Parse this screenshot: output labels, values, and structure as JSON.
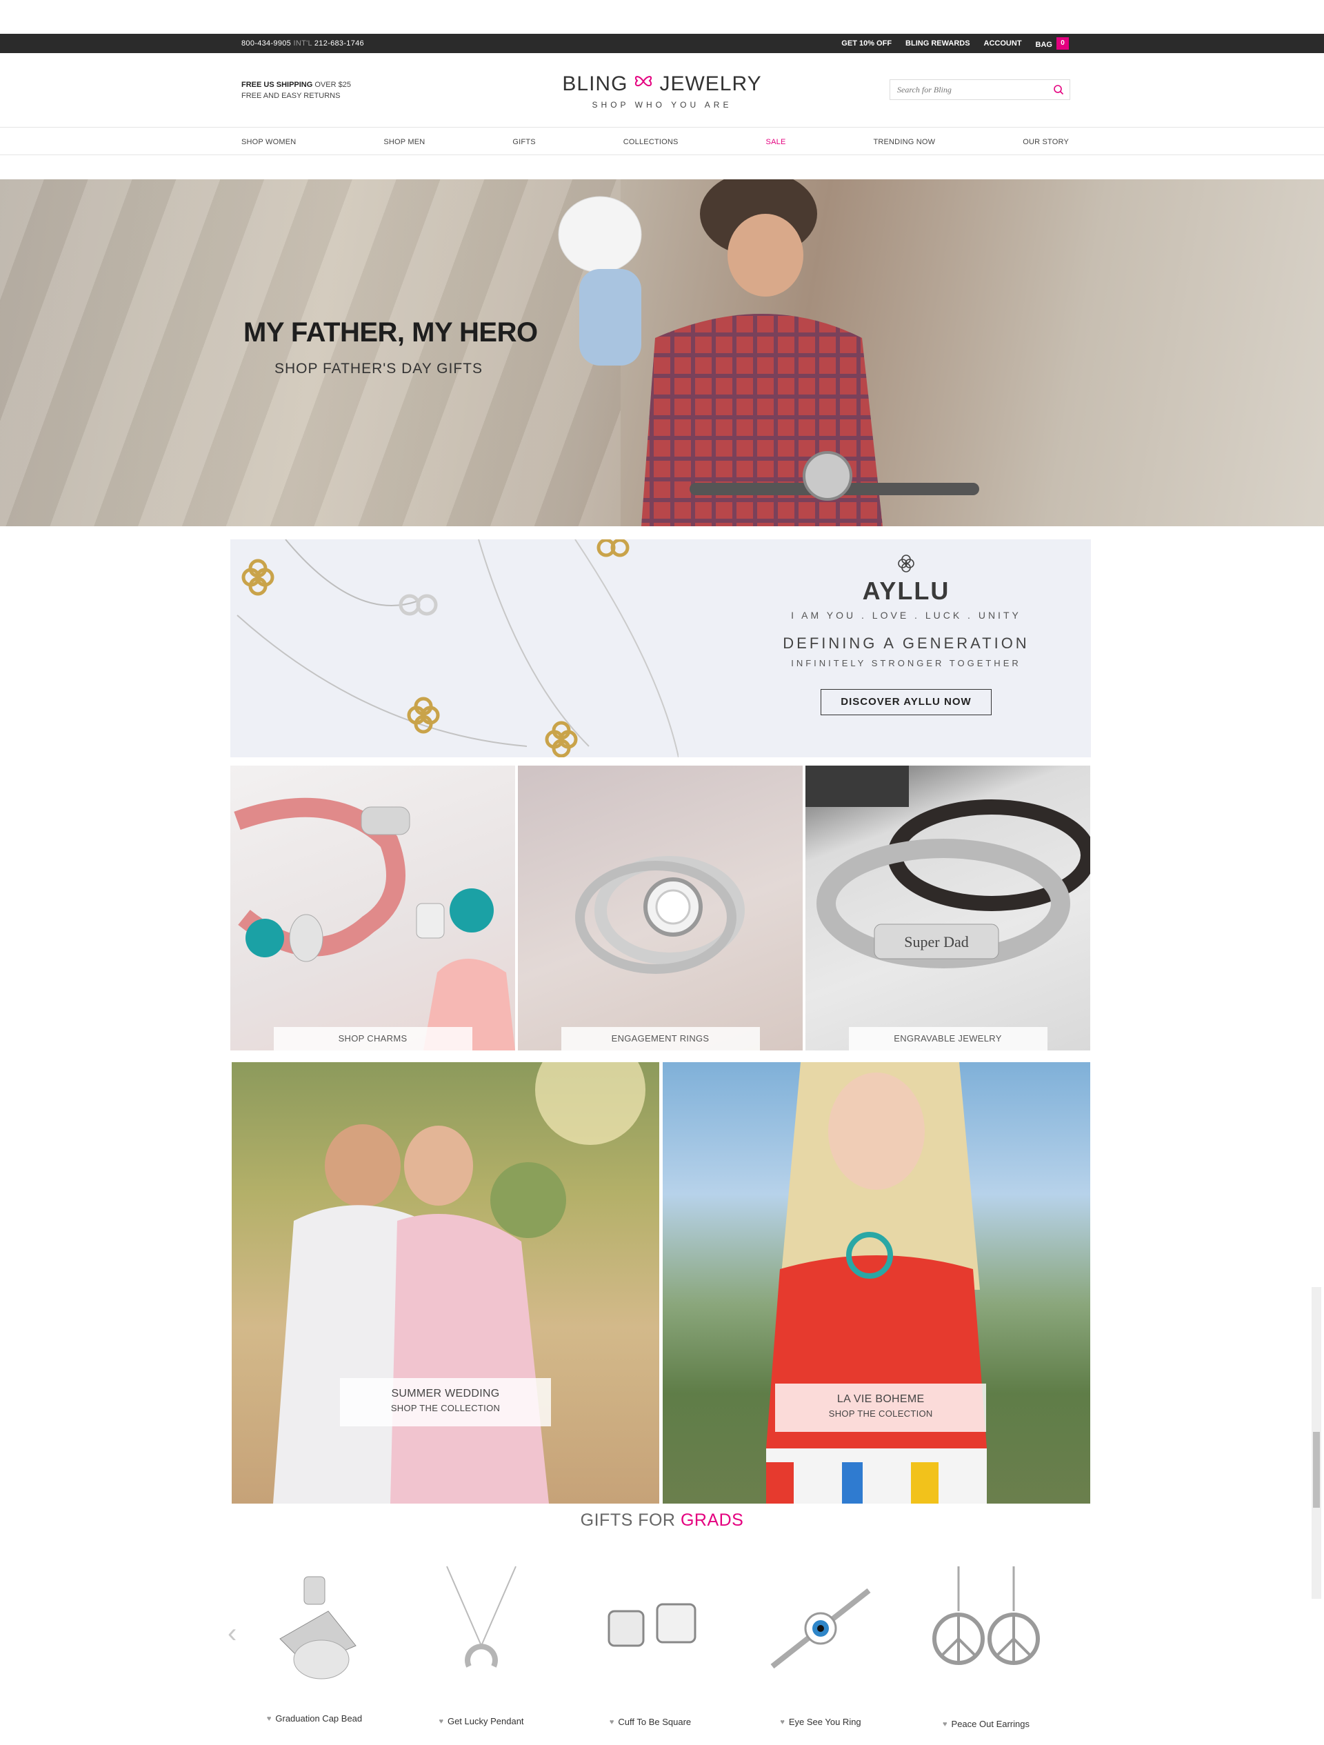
{
  "topbar": {
    "phone": "800-434-9905",
    "intl_label": "INT'L",
    "intl_phone": "212-683-1746",
    "links": [
      "GET 10% OFF",
      "BLING REWARDS",
      "ACCOUNT"
    ],
    "bag_label": "BAG",
    "bag_count": "0",
    "accent": "#e4007f"
  },
  "header": {
    "shipping_bold": "FREE US SHIPPING",
    "shipping_rest": "OVER $25",
    "returns": "FREE AND EASY RETURNS",
    "logo_left": "BLING",
    "logo_right": "JEWELRY",
    "tagline": "SHOP WHO YOU ARE",
    "search_placeholder": "Search for Bling"
  },
  "nav": {
    "items": [
      "SHOP WOMEN",
      "SHOP MEN",
      "GIFTS",
      "COLLECTIONS",
      "SALE",
      "TRENDING NOW",
      "OUR STORY"
    ]
  },
  "hero": {
    "title": "MY FATHER, MY HERO",
    "subtitle": "SHOP FATHER'S DAY GIFTS"
  },
  "ayllu": {
    "brand": "AYLLU",
    "tagline": "I AM YOU . LOVE . LUCK . UNITY",
    "headline": "DEFINING A GENERATION",
    "subline": "INFINITELY STRONGER TOGETHER",
    "button": "DISCOVER AYLLU NOW"
  },
  "tiles": {
    "charms": "SHOP CHARMS",
    "rings": "ENGAGEMENT RINGS",
    "engravable": "ENGRAVABLE JEWELRY",
    "engrave_text": "Super Dad"
  },
  "collections": {
    "wedding_title": "SUMMER WEDDING",
    "wedding_sub": "SHOP THE COLLECTION",
    "boheme_title": "LA VIE BOHEME",
    "boheme_sub": "SHOP THE COLECTION"
  },
  "grads": {
    "title_gray": "GIFTS FOR",
    "title_pink": "GRADS",
    "products": [
      "Graduation Cap Bead",
      "Get Lucky Pendant",
      "Cuff To Be Square",
      "Eye See You Ring",
      "Peace Out Earrings"
    ]
  }
}
